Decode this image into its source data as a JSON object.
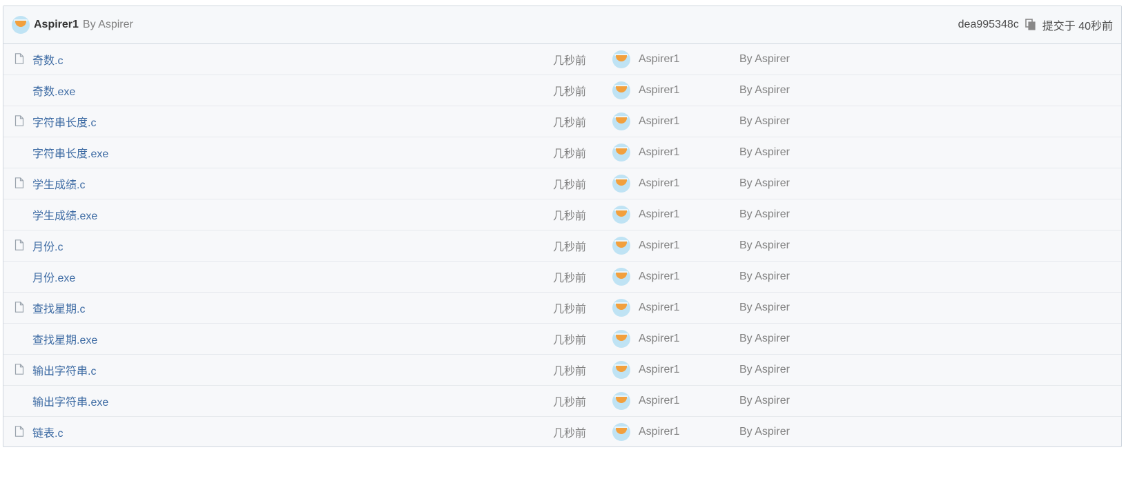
{
  "header": {
    "author": "Aspirer1",
    "by": "By Aspirer",
    "commit_hash": "dea995348c",
    "committed_label": "提交于 40秒前"
  },
  "files": [
    {
      "name": "奇数.c",
      "time": "几秒前",
      "author": "Aspirer1",
      "by": "By Aspirer",
      "icon": "file-icon"
    },
    {
      "name": "奇数.exe",
      "time": "几秒前",
      "author": "Aspirer1",
      "by": "By Aspirer",
      "icon": ""
    },
    {
      "name": "字符串长度.c",
      "time": "几秒前",
      "author": "Aspirer1",
      "by": "By Aspirer",
      "icon": "file-icon"
    },
    {
      "name": "字符串长度.exe",
      "time": "几秒前",
      "author": "Aspirer1",
      "by": "By Aspirer",
      "icon": ""
    },
    {
      "name": "学生成绩.c",
      "time": "几秒前",
      "author": "Aspirer1",
      "by": "By Aspirer",
      "icon": "file-icon"
    },
    {
      "name": "学生成绩.exe",
      "time": "几秒前",
      "author": "Aspirer1",
      "by": "By Aspirer",
      "icon": ""
    },
    {
      "name": "月份.c",
      "time": "几秒前",
      "author": "Aspirer1",
      "by": "By Aspirer",
      "icon": "file-icon"
    },
    {
      "name": "月份.exe",
      "time": "几秒前",
      "author": "Aspirer1",
      "by": "By Aspirer",
      "icon": ""
    },
    {
      "name": "查找星期.c",
      "time": "几秒前",
      "author": "Aspirer1",
      "by": "By Aspirer",
      "icon": "file-icon"
    },
    {
      "name": "查找星期.exe",
      "time": "几秒前",
      "author": "Aspirer1",
      "by": "By Aspirer",
      "icon": ""
    },
    {
      "name": "输出字符串.c",
      "time": "几秒前",
      "author": "Aspirer1",
      "by": "By Aspirer",
      "icon": "file-icon"
    },
    {
      "name": "输出字符串.exe",
      "time": "几秒前",
      "author": "Aspirer1",
      "by": "By Aspirer",
      "icon": ""
    },
    {
      "name": "链表.c",
      "time": "几秒前",
      "author": "Aspirer1",
      "by": "By Aspirer",
      "icon": "file-icon"
    }
  ]
}
